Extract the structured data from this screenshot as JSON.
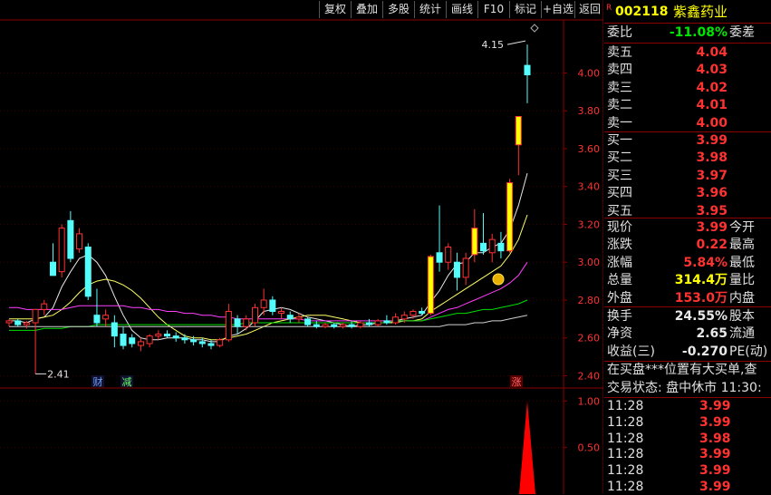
{
  "toolbar": {
    "buttons": [
      "复权",
      "叠加",
      "多股",
      "统计",
      "画线",
      "F10",
      "标记",
      "+自选",
      "返回"
    ]
  },
  "stock": {
    "flag": "R",
    "code": "002118",
    "name": "紫鑫药业"
  },
  "quote": {
    "weibi_label": "委比",
    "weibi_value": "-11.08%",
    "weicha_label": "委差",
    "asks": [
      {
        "label": "卖五",
        "price": "4.04"
      },
      {
        "label": "卖四",
        "price": "4.03"
      },
      {
        "label": "卖三",
        "price": "4.02"
      },
      {
        "label": "卖二",
        "price": "4.01"
      },
      {
        "label": "卖一",
        "price": "4.00"
      }
    ],
    "bids": [
      {
        "label": "买一",
        "price": "3.99"
      },
      {
        "label": "买二",
        "price": "3.98"
      },
      {
        "label": "买三",
        "price": "3.97"
      },
      {
        "label": "买四",
        "price": "3.96"
      },
      {
        "label": "买五",
        "price": "3.95"
      }
    ],
    "stats": [
      {
        "label": "现价",
        "value": "3.99",
        "color": "red",
        "label2": "今开"
      },
      {
        "label": "涨跌",
        "value": "0.22",
        "color": "red",
        "label2": "最高"
      },
      {
        "label": "涨幅",
        "value": "5.84%",
        "color": "red",
        "label2": "最低"
      },
      {
        "label": "总量",
        "value": "314.4万",
        "color": "yellow",
        "label2": "量比"
      },
      {
        "label": "外盘",
        "value": "153.0万",
        "color": "red",
        "label2": "内盘"
      }
    ],
    "stats2": [
      {
        "label": "换手",
        "value": "24.55%",
        "color": "white",
        "label2": "股本"
      },
      {
        "label": "净资",
        "value": "2.65",
        "color": "white",
        "label2": "流通"
      },
      {
        "label": "收益(三)",
        "value": "-0.270",
        "color": "white",
        "label2": "PE(动)"
      }
    ],
    "notice": "在买盘***位置有大买单,查",
    "status": "交易状态: 盘中休市 11:30:",
    "trades": [
      {
        "time": "11:28",
        "price": "3.99"
      },
      {
        "time": "11:28",
        "price": "3.99"
      },
      {
        "time": "11:28",
        "price": "3.98"
      },
      {
        "time": "11:28",
        "price": "3.99"
      },
      {
        "time": "11:28",
        "price": "3.99"
      },
      {
        "time": "11:28",
        "price": "3.99"
      }
    ]
  },
  "chart_data": {
    "type": "candlestick",
    "price_axis": {
      "ticks": [
        "4.00",
        "3.80",
        "3.60",
        "3.40",
        "3.20",
        "3.00",
        "2.80",
        "2.60",
        "2.40"
      ],
      "ylim": [
        2.34,
        4.28
      ]
    },
    "volume_axis": {
      "ticks": [
        "1.00",
        "0.50"
      ],
      "ylim": [
        0,
        1.12
      ]
    },
    "annotations": {
      "high_label": "4.15",
      "low_label": "2.41",
      "marks": [
        "财",
        "减",
        "涨"
      ]
    },
    "candles": [
      {
        "o": 2.68,
        "h": 2.7,
        "l": 2.66,
        "c": 2.69
      },
      {
        "o": 2.69,
        "h": 2.7,
        "l": 2.66,
        "c": 2.67
      },
      {
        "o": 2.67,
        "h": 2.69,
        "l": 2.65,
        "c": 2.68
      },
      {
        "o": 2.68,
        "h": 2.72,
        "l": 2.41,
        "c": 2.75
      },
      {
        "o": 2.75,
        "h": 2.8,
        "l": 2.72,
        "c": 2.78
      },
      {
        "o": 3.0,
        "h": 3.1,
        "l": 2.95,
        "c": 2.93
      },
      {
        "o": 2.95,
        "h": 3.2,
        "l": 2.92,
        "c": 3.18
      },
      {
        "o": 3.22,
        "h": 3.27,
        "l": 3.0,
        "c": 3.02
      },
      {
        "o": 3.07,
        "h": 3.18,
        "l": 3.05,
        "c": 3.15
      },
      {
        "o": 3.08,
        "h": 3.1,
        "l": 2.8,
        "c": 2.82
      },
      {
        "o": 2.72,
        "h": 2.86,
        "l": 2.66,
        "c": 2.68
      },
      {
        "o": 2.7,
        "h": 2.75,
        "l": 2.66,
        "c": 2.72
      },
      {
        "o": 2.68,
        "h": 2.72,
        "l": 2.55,
        "c": 2.61
      },
      {
        "o": 2.62,
        "h": 2.66,
        "l": 2.54,
        "c": 2.56
      },
      {
        "o": 2.6,
        "h": 2.62,
        "l": 2.55,
        "c": 2.57
      },
      {
        "o": 2.56,
        "h": 2.6,
        "l": 2.53,
        "c": 2.58
      },
      {
        "o": 2.57,
        "h": 2.62,
        "l": 2.55,
        "c": 2.61
      },
      {
        "o": 2.61,
        "h": 2.64,
        "l": 2.59,
        "c": 2.62
      },
      {
        "o": 2.62,
        "h": 2.64,
        "l": 2.6,
        "c": 2.61
      },
      {
        "o": 2.61,
        "h": 2.63,
        "l": 2.58,
        "c": 2.6
      },
      {
        "o": 2.6,
        "h": 2.62,
        "l": 2.57,
        "c": 2.59
      },
      {
        "o": 2.59,
        "h": 2.61,
        "l": 2.56,
        "c": 2.58
      },
      {
        "o": 2.58,
        "h": 2.6,
        "l": 2.55,
        "c": 2.57
      },
      {
        "o": 2.57,
        "h": 2.59,
        "l": 2.54,
        "c": 2.56
      },
      {
        "o": 2.56,
        "h": 2.6,
        "l": 2.55,
        "c": 2.59
      },
      {
        "o": 2.59,
        "h": 2.78,
        "l": 2.58,
        "c": 2.74
      },
      {
        "o": 2.7,
        "h": 2.72,
        "l": 2.62,
        "c": 2.66
      },
      {
        "o": 2.66,
        "h": 2.72,
        "l": 2.64,
        "c": 2.7
      },
      {
        "o": 2.68,
        "h": 2.78,
        "l": 2.66,
        "c": 2.76
      },
      {
        "o": 2.76,
        "h": 2.86,
        "l": 2.72,
        "c": 2.8
      },
      {
        "o": 2.8,
        "h": 2.82,
        "l": 2.72,
        "c": 2.74
      },
      {
        "o": 2.73,
        "h": 2.76,
        "l": 2.7,
        "c": 2.74
      },
      {
        "o": 2.72,
        "h": 2.74,
        "l": 2.68,
        "c": 2.7
      },
      {
        "o": 2.7,
        "h": 2.73,
        "l": 2.68,
        "c": 2.71
      },
      {
        "o": 2.7,
        "h": 2.71,
        "l": 2.66,
        "c": 2.67
      },
      {
        "o": 2.67,
        "h": 2.69,
        "l": 2.65,
        "c": 2.66
      },
      {
        "o": 2.66,
        "h": 2.68,
        "l": 2.65,
        "c": 2.67
      },
      {
        "o": 2.67,
        "h": 2.68,
        "l": 2.65,
        "c": 2.66
      },
      {
        "o": 2.66,
        "h": 2.68,
        "l": 2.65,
        "c": 2.67
      },
      {
        "o": 2.67,
        "h": 2.69,
        "l": 2.65,
        "c": 2.66
      },
      {
        "o": 2.66,
        "h": 2.69,
        "l": 2.65,
        "c": 2.68
      },
      {
        "o": 2.68,
        "h": 2.7,
        "l": 2.66,
        "c": 2.67
      },
      {
        "o": 2.67,
        "h": 2.7,
        "l": 2.66,
        "c": 2.69
      },
      {
        "o": 2.69,
        "h": 2.72,
        "l": 2.67,
        "c": 2.68
      },
      {
        "o": 2.68,
        "h": 2.73,
        "l": 2.67,
        "c": 2.71
      },
      {
        "o": 2.7,
        "h": 2.74,
        "l": 2.68,
        "c": 2.72
      },
      {
        "o": 2.72,
        "h": 2.75,
        "l": 2.7,
        "c": 2.74
      },
      {
        "o": 2.74,
        "h": 2.76,
        "l": 2.72,
        "c": 2.73
      },
      {
        "o": 2.73,
        "h": 3.04,
        "l": 2.72,
        "c": 3.03
      },
      {
        "o": 3.05,
        "h": 3.3,
        "l": 2.95,
        "c": 3.0
      },
      {
        "o": 3.0,
        "h": 3.1,
        "l": 2.96,
        "c": 3.08
      },
      {
        "o": 3.0,
        "h": 3.05,
        "l": 2.85,
        "c": 2.92
      },
      {
        "o": 2.92,
        "h": 3.05,
        "l": 2.88,
        "c": 3.02
      },
      {
        "o": 3.04,
        "h": 3.28,
        "l": 3.0,
        "c": 3.18
      },
      {
        "o": 3.1,
        "h": 3.26,
        "l": 3.04,
        "c": 3.06
      },
      {
        "o": 3.05,
        "h": 3.15,
        "l": 3.0,
        "c": 3.12
      },
      {
        "o": 3.1,
        "h": 3.16,
        "l": 3.02,
        "c": 3.06
      },
      {
        "o": 3.06,
        "h": 3.44,
        "l": 3.05,
        "c": 3.42
      },
      {
        "o": 3.62,
        "h": 3.77,
        "l": 3.46,
        "c": 3.77
      },
      {
        "o": 4.04,
        "h": 4.15,
        "l": 3.84,
        "c": 3.99
      }
    ],
    "ma_series": [
      {
        "color": "#e8e8e8",
        "values": [
          2.69,
          2.69,
          2.68,
          2.7,
          2.71,
          2.76,
          2.87,
          2.95,
          3.02,
          3.04,
          3.0,
          2.93,
          2.82,
          2.72,
          2.64,
          2.6,
          2.59,
          2.59,
          2.6,
          2.6,
          2.6,
          2.59,
          2.59,
          2.58,
          2.58,
          2.61,
          2.62,
          2.65,
          2.69,
          2.74,
          2.75,
          2.76,
          2.75,
          2.73,
          2.71,
          2.7,
          2.69,
          2.68,
          2.67,
          2.66,
          2.67,
          2.67,
          2.68,
          2.68,
          2.69,
          2.7,
          2.71,
          2.72,
          2.79,
          2.85,
          2.93,
          2.99,
          3.0,
          3.05,
          3.05,
          3.08,
          3.1,
          3.17,
          3.3,
          3.47
        ]
      },
      {
        "color": "#ffff66",
        "values": [
          2.7,
          2.7,
          2.7,
          2.7,
          2.71,
          2.72,
          2.75,
          2.79,
          2.84,
          2.88,
          2.9,
          2.91,
          2.9,
          2.88,
          2.85,
          2.81,
          2.76,
          2.71,
          2.67,
          2.64,
          2.61,
          2.6,
          2.6,
          2.59,
          2.59,
          2.6,
          2.61,
          2.62,
          2.64,
          2.66,
          2.68,
          2.69,
          2.7,
          2.71,
          2.72,
          2.72,
          2.72,
          2.71,
          2.7,
          2.69,
          2.68,
          2.68,
          2.68,
          2.68,
          2.68,
          2.69,
          2.69,
          2.7,
          2.74,
          2.77,
          2.8,
          2.83,
          2.86,
          2.89,
          2.92,
          2.95,
          2.98,
          3.04,
          3.12,
          3.25
        ]
      },
      {
        "color": "#ff40ff",
        "values": [
          2.76,
          2.76,
          2.75,
          2.75,
          2.75,
          2.75,
          2.75,
          2.76,
          2.77,
          2.77,
          2.77,
          2.77,
          2.77,
          2.77,
          2.76,
          2.76,
          2.75,
          2.75,
          2.74,
          2.74,
          2.73,
          2.73,
          2.72,
          2.72,
          2.71,
          2.71,
          2.7,
          2.7,
          2.7,
          2.7,
          2.7,
          2.7,
          2.7,
          2.7,
          2.69,
          2.69,
          2.69,
          2.69,
          2.69,
          2.69,
          2.69,
          2.69,
          2.69,
          2.69,
          2.69,
          2.69,
          2.69,
          2.69,
          2.71,
          2.73,
          2.75,
          2.76,
          2.78,
          2.8,
          2.82,
          2.84,
          2.86,
          2.89,
          2.93,
          3.0
        ]
      },
      {
        "color": "#00e000",
        "values": [
          2.64,
          2.64,
          2.64,
          2.64,
          2.65,
          2.65,
          2.65,
          2.66,
          2.66,
          2.66,
          2.67,
          2.67,
          2.67,
          2.67,
          2.67,
          2.67,
          2.67,
          2.67,
          2.67,
          2.67,
          2.67,
          2.67,
          2.67,
          2.67,
          2.67,
          2.67,
          2.67,
          2.68,
          2.68,
          2.68,
          2.68,
          2.68,
          2.68,
          2.68,
          2.68,
          2.68,
          2.68,
          2.68,
          2.68,
          2.68,
          2.68,
          2.68,
          2.68,
          2.68,
          2.69,
          2.69,
          2.69,
          2.69,
          2.7,
          2.71,
          2.72,
          2.73,
          2.73,
          2.74,
          2.75,
          2.75,
          2.76,
          2.77,
          2.78,
          2.8
        ]
      },
      {
        "color": "#d0d0d0",
        "values": [
          2.66,
          2.66,
          2.66,
          2.66,
          2.66,
          2.66,
          2.66,
          2.66,
          2.66,
          2.66,
          2.66,
          2.66,
          2.66,
          2.66,
          2.66,
          2.66,
          2.66,
          2.66,
          2.66,
          2.66,
          2.66,
          2.66,
          2.66,
          2.66,
          2.66,
          2.66,
          2.66,
          2.66,
          2.66,
          2.66,
          2.66,
          2.66,
          2.66,
          2.66,
          2.66,
          2.66,
          2.66,
          2.66,
          2.66,
          2.66,
          2.66,
          2.66,
          2.66,
          2.66,
          2.66,
          2.66,
          2.66,
          2.66,
          2.66,
          2.66,
          2.67,
          2.67,
          2.67,
          2.68,
          2.68,
          2.69,
          2.69,
          2.7,
          2.71,
          2.72
        ]
      }
    ],
    "volume": [
      0,
      0,
      0,
      0,
      0,
      0,
      0,
      0,
      0,
      0,
      0,
      0,
      0,
      0,
      0,
      0,
      0,
      0,
      0,
      0,
      0,
      0,
      0,
      0,
      0,
      0,
      0,
      0,
      0,
      0,
      0,
      0,
      0,
      0,
      0,
      0,
      0,
      0,
      0,
      0,
      0,
      0,
      0,
      0,
      0,
      0,
      0,
      0,
      0,
      0,
      0,
      0,
      0,
      0,
      0,
      0,
      0,
      0,
      0,
      1.0
    ]
  }
}
